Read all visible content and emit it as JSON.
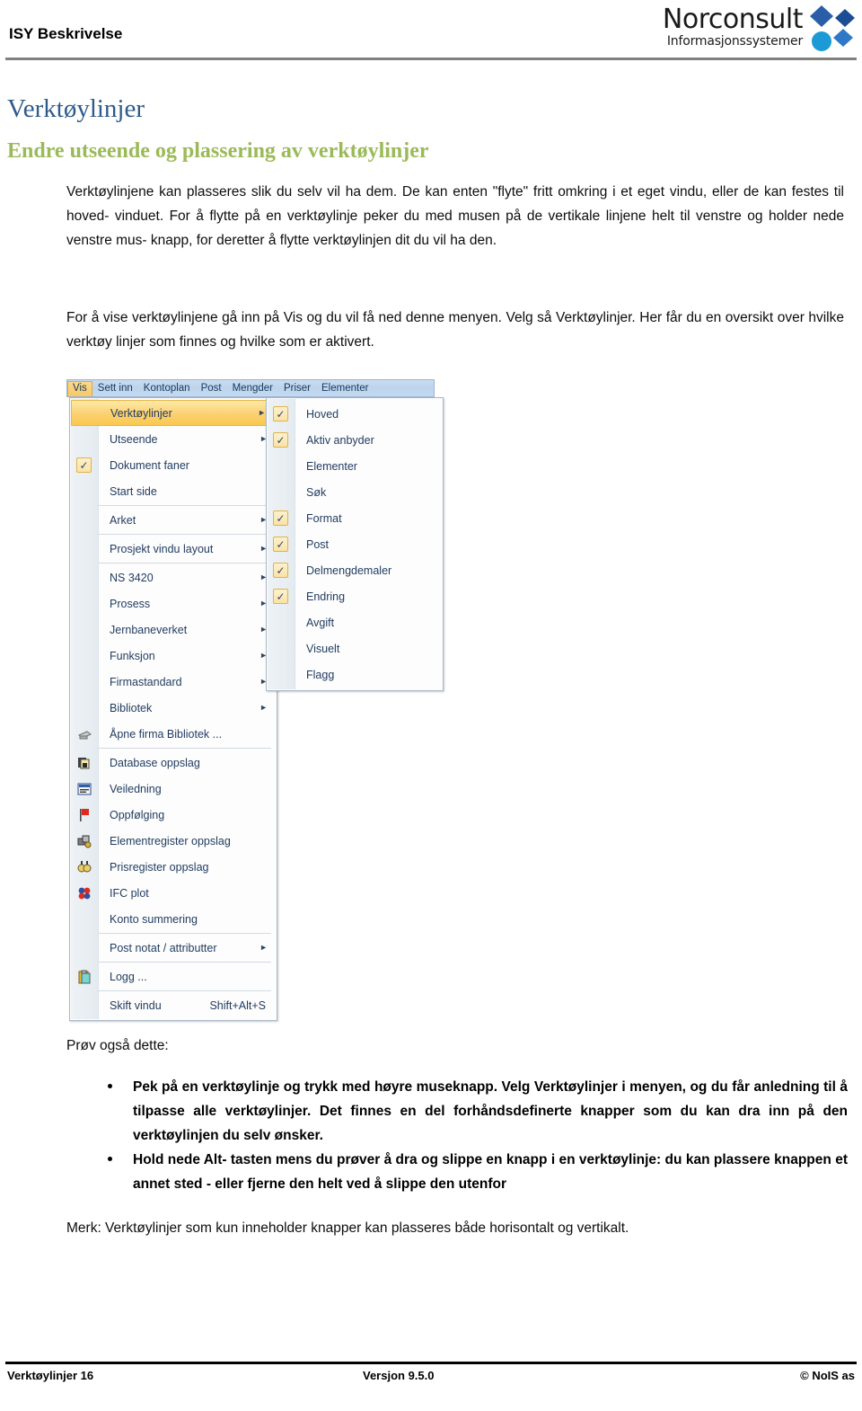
{
  "header": {
    "doc_title": "ISY Beskrivelse",
    "logo_word": "Norconsult",
    "logo_sub": "Informasjonssystemer"
  },
  "titles": {
    "h1": "Verktøylinjer",
    "h2": "Endre utseende og plassering av verktøylinjer"
  },
  "body": {
    "para_1": "Verktøylinjene kan plasseres slik du selv vil ha dem. De kan enten \"flyte\" fritt omkring i et eget vindu, eller de kan festes til hoved- vinduet. For å flytte på en verktøylinje peker du med musen på de vertikale linjene helt til venstre og holder nede venstre mus- knapp, for deretter å flytte verktøylinjen dit du vil ha den.",
    "para_2": "For å vise verktøylinjene gå inn på Vis og du vil få ned denne menyen. Velg så Verktøylinjer. Her får du en oversikt over hvilke verktøy linjer som finnes og hvilke som er aktivert.",
    "prov_label": "Prøv også dette:",
    "bullets": [
      "Pek på en verktøylinje og trykk med høyre museknapp. Velg Verktøylinjer i menyen, og du får anledning til å tilpasse alle verktøylinjer. Det finnes en del forhåndsdefinerte knapper som du kan dra inn på den verktøylinjen du selv ønsker.",
      "Hold nede Alt- tasten mens du prøver å dra og slippe en knapp i en verktøylinje: du kan plassere knappen et annet sted - eller fjerne den helt ved å slippe den utenfor"
    ],
    "merk": "Merk: Verktøylinjer som kun inneholder knapper kan plasseres både horisontalt og vertikalt."
  },
  "screenshot": {
    "menubar": [
      {
        "label": "Vis",
        "active": true
      },
      {
        "label": "Sett inn",
        "active": false
      },
      {
        "label": "Kontoplan",
        "active": false
      },
      {
        "label": "Post",
        "active": false
      },
      {
        "label": "Mengder",
        "active": false
      },
      {
        "label": "Priser",
        "active": false
      },
      {
        "label": "Elementer",
        "active": false
      }
    ],
    "vis_menu": [
      {
        "label": "Verktøylinjer",
        "arrow": "►",
        "checked": false,
        "highlight": true,
        "icon": "",
        "sep_after": false
      },
      {
        "label": "Utseende",
        "arrow": "►",
        "checked": false,
        "highlight": false,
        "icon": "",
        "sep_after": false
      },
      {
        "label": "Dokument faner",
        "arrow": "",
        "checked": true,
        "highlight": false,
        "icon": "",
        "sep_after": false
      },
      {
        "label": "Start side",
        "arrow": "",
        "checked": false,
        "highlight": false,
        "icon": "",
        "sep_after": true
      },
      {
        "label": "Arket",
        "arrow": "►",
        "checked": false,
        "highlight": false,
        "icon": "",
        "sep_after": true
      },
      {
        "label": "Prosjekt vindu layout",
        "arrow": "►",
        "checked": false,
        "highlight": false,
        "icon": "",
        "sep_after": true
      },
      {
        "label": "NS 3420",
        "arrow": "►",
        "checked": false,
        "highlight": false,
        "icon": "",
        "sep_after": false
      },
      {
        "label": "Prosess",
        "arrow": "►",
        "checked": false,
        "highlight": false,
        "icon": "",
        "sep_after": false
      },
      {
        "label": "Jernbaneverket",
        "arrow": "►",
        "checked": false,
        "highlight": false,
        "icon": "",
        "sep_after": false
      },
      {
        "label": "Funksjon",
        "arrow": "►",
        "checked": false,
        "highlight": false,
        "icon": "",
        "sep_after": false
      },
      {
        "label": "Firmastandard",
        "arrow": "►",
        "checked": false,
        "highlight": false,
        "icon": "",
        "sep_after": false
      },
      {
        "label": "Bibliotek",
        "arrow": "►",
        "checked": false,
        "highlight": false,
        "icon": "",
        "sep_after": false
      },
      {
        "label": "Åpne firma Bibliotek ...",
        "arrow": "",
        "checked": false,
        "highlight": false,
        "icon": "printer-icon",
        "sep_after": true
      },
      {
        "label": "Database oppslag",
        "arrow": "",
        "checked": false,
        "highlight": false,
        "icon": "database-icon",
        "sep_after": false
      },
      {
        "label": "Veiledning",
        "arrow": "",
        "checked": false,
        "highlight": false,
        "icon": "guide-icon",
        "sep_after": false
      },
      {
        "label": "Oppfølging",
        "arrow": "",
        "checked": false,
        "highlight": false,
        "icon": "flag-icon",
        "sep_after": false
      },
      {
        "label": "Elementregister oppslag",
        "arrow": "",
        "checked": false,
        "highlight": false,
        "icon": "element-register-icon",
        "sep_after": false
      },
      {
        "label": "Prisregister oppslag",
        "arrow": "",
        "checked": false,
        "highlight": false,
        "icon": "price-register-icon",
        "sep_after": false
      },
      {
        "label": "IFC plot",
        "arrow": "",
        "checked": false,
        "highlight": false,
        "icon": "ifc-plot-icon",
        "sep_after": false
      },
      {
        "label": "Konto summering",
        "arrow": "",
        "checked": false,
        "highlight": false,
        "icon": "",
        "sep_after": true
      },
      {
        "label": "Post notat / attributter",
        "arrow": "►",
        "checked": false,
        "highlight": false,
        "icon": "",
        "sep_after": true
      },
      {
        "label": "Logg ...",
        "arrow": "",
        "checked": false,
        "highlight": false,
        "icon": "clipboard-icon",
        "sep_after": true
      },
      {
        "label": "Skift vindu",
        "arrow": "",
        "shortcut": "Shift+Alt+S",
        "checked": false,
        "highlight": false,
        "icon": "",
        "sep_after": false
      }
    ],
    "toolbars_submenu": [
      {
        "label": "Hoved",
        "checked": true
      },
      {
        "label": "Aktiv anbyder",
        "checked": true
      },
      {
        "label": "Elementer",
        "checked": false
      },
      {
        "label": "Søk",
        "checked": false
      },
      {
        "label": "Format",
        "checked": true
      },
      {
        "label": "Post",
        "checked": true
      },
      {
        "label": "Delmengdemaler",
        "checked": true
      },
      {
        "label": "Endring",
        "checked": true
      },
      {
        "label": "Avgift",
        "checked": false
      },
      {
        "label": "Visuelt",
        "checked": false
      },
      {
        "label": "Flagg",
        "checked": false
      }
    ],
    "checkmark_glyph": "✓"
  },
  "footer": {
    "left": "Verktøylinjer 16",
    "middle": "Versjon 9.5.0",
    "right": "© NoIS as"
  }
}
